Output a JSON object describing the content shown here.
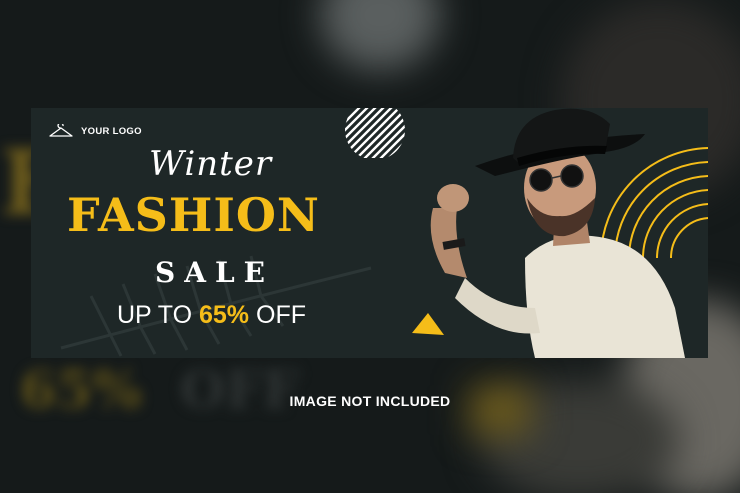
{
  "banner": {
    "logo_text": "YOUR LOGO",
    "script_title": "Winter",
    "headline": "FASHION",
    "subheadline": "SALE",
    "offer_prefix": "UP TO",
    "offer_value": "65%",
    "offer_suffix": "OFF"
  },
  "caption": "IMAGE NOT INCLUDED",
  "colors": {
    "accent": "#f5bd19",
    "banner_bg": "#1e2727",
    "page_bg": "#151a1a",
    "text": "#ffffff"
  },
  "icons": [
    "hanger-icon",
    "striped-circle",
    "yellow-triangle",
    "concentric-arcs"
  ]
}
